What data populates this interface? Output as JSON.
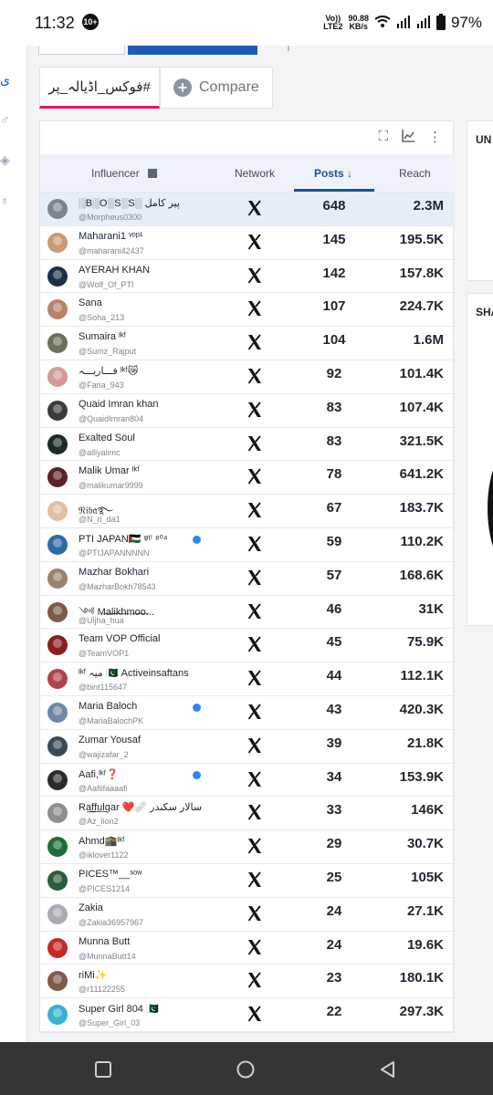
{
  "status_bar": {
    "time": "11:32",
    "notification_count": "10+",
    "network_line1": "Vo))",
    "network_line2": "LTE2",
    "speed_value": "90.88",
    "speed_unit": "KB/s",
    "battery": "97%"
  },
  "tabs": {
    "active_label": "#فوکس_اڈیالہ_پر",
    "compare_label": "Compare"
  },
  "table": {
    "headers": {
      "influencer": "Influencer",
      "network": "Network",
      "posts": "Posts",
      "reach": "Reach"
    },
    "rows": [
      {
        "name": "░B░O░S░S░ پیر کامل",
        "handle": "@Morpheus0300",
        "posts": "648",
        "reach": "2.3M"
      },
      {
        "name": "Maharani1 ᵛᵒᵖ¹",
        "handle": "@maharani42437",
        "posts": "145",
        "reach": "195.5K"
      },
      {
        "name": "AYERAH KHAN",
        "handle": "@Wolf_Of_PTI",
        "posts": "142",
        "reach": "157.8K"
      },
      {
        "name": "Sana",
        "handle": "@Soha_213",
        "posts": "107",
        "reach": "224.7K"
      },
      {
        "name": "Sumaira ᴵᵏᶠ",
        "handle": "@Sumz_Rajput",
        "posts": "104",
        "reach": "1.6M"
      },
      {
        "name": "فـــاریـــہ ᴵᵏᶠ😿",
        "handle": "@Faria_943",
        "posts": "92",
        "reach": "101.4K"
      },
      {
        "name": "Quaid Imran khan",
        "handle": "@QuaidImran804",
        "posts": "83",
        "reach": "107.4K"
      },
      {
        "name": "Exalted Soul",
        "handle": "@alliyaiimc",
        "posts": "83",
        "reach": "321.5K"
      },
      {
        "name": "Malik Umar ᴵᵏᶠ",
        "handle": "@malikumar9999",
        "posts": "78",
        "reach": "641.2K"
      },
      {
        "name": "𝔑𝔦𝔟𝔞࿐",
        "handle": "@N_ri_da1",
        "posts": "67",
        "reach": "183.7K"
      },
      {
        "name": "PTI JAPAN🇵🇸 ᵠᵗⁱ ⁸⁰⁴",
        "handle": "@PTIJAPANNNNN",
        "posts": "59",
        "reach": "110.2K"
      },
      {
        "name": "Mazhar Bokhari",
        "handle": "@MazharBokh78543",
        "posts": "57",
        "reach": "168.6K"
      },
      {
        "name": "༺ M̶a̶l̶i̶k̶h̶m̶o̶o̶...",
        "handle": "@Uljha_hua",
        "posts": "46",
        "reach": "31K"
      },
      {
        "name": "Team VOP Official",
        "handle": "@TeamVOP1",
        "posts": "45",
        "reach": "75.9K"
      },
      {
        "name": "ᴵᵏᶠ میہ 🇵🇰 Activeinsaftans",
        "handle": "@bint115647",
        "posts": "44",
        "reach": "112.1K"
      },
      {
        "name": "Maria Baloch",
        "handle": "@MariaBalochPK",
        "posts": "43",
        "reach": "420.3K"
      },
      {
        "name": "Zumar Yousaf",
        "handle": "@wajizafar_2",
        "posts": "39",
        "reach": "21.8K"
      },
      {
        "name": "Aafi,ᴵᵏᶠ❓",
        "handle": "@Aafiifaaaafi",
        "posts": "34",
        "reach": "153.9K"
      },
      {
        "name": "Ra͟f͟f͟u͟lgar ❤️🩹 سالار سکندر",
        "handle": "@Az_lion2",
        "posts": "33",
        "reach": "146K"
      },
      {
        "name": "Ahmd🕋ᴵᵏᶠ",
        "handle": "@iklover1122",
        "posts": "29",
        "reach": "30.7K"
      },
      {
        "name": "PICES™__ˢᵒʷ",
        "handle": "@PICES1214",
        "posts": "25",
        "reach": "105K"
      },
      {
        "name": "Zakia",
        "handle": "@Zakia36957967",
        "posts": "24",
        "reach": "27.1K"
      },
      {
        "name": "Munna Butt",
        "handle": "@MunnaButt14",
        "posts": "24",
        "reach": "19.6K"
      },
      {
        "name": "riMi✨",
        "handle": "@r11122255",
        "posts": "23",
        "reach": "180.1K"
      },
      {
        "name": "Super Girl 804 🇵🇰",
        "handle": "@Super_Girl_03",
        "posts": "22",
        "reach": "297.3K"
      }
    ]
  },
  "side_cards": {
    "card1_title": "UN",
    "card2_title": "SHA"
  },
  "colors": {
    "accent_pink": "#e2126f",
    "posts_blue": "#1f4f9c",
    "header_bg": "#eef3fa"
  }
}
